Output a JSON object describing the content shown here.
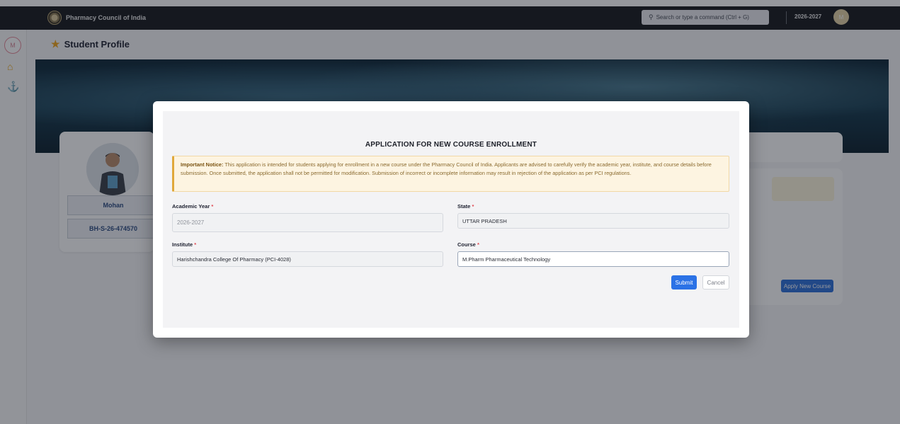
{
  "topbar": {
    "brand": "Pharmacy Council of India",
    "search_placeholder": "Search or type a command (Ctrl + G)",
    "year": "2026-2027",
    "avatar_initial": "M"
  },
  "leftrail": {
    "avatar_initial": "M",
    "icons": [
      "home-icon",
      "anchor-icon"
    ]
  },
  "page": {
    "title": "Student Profile"
  },
  "profile": {
    "name": "Mohan",
    "id": "BH-S-26-474570"
  },
  "side_actions": {
    "apply_label": "Apply New Course"
  },
  "modal": {
    "title": "APPLICATION FOR NEW COURSE ENROLLMENT",
    "notice_heading": "Important Notice:",
    "notice_text": " This application is intended for students applying for enrollment in a new course under the Pharmacy Council of India. Applicants are advised to carefully verify the academic year, institute, and course details before submission. Once submitted, the application shall not be permitted for modification. Submission of incorrect or incomplete information may result in rejection of the application as per PCI regulations.",
    "fields": {
      "academic_year": {
        "label": "Academic Year",
        "value": "2026-2027"
      },
      "state": {
        "label": "State",
        "value": "UTTAR PRADESH"
      },
      "institute": {
        "label": "Institute",
        "value": "Harishchandra College Of Pharmacy (PCI-4028)"
      },
      "course": {
        "label": "Course",
        "value": "M.Pharm Pharmaceutical Technology"
      }
    },
    "required_mark": "*",
    "submit_label": "Submit",
    "cancel_label": "Cancel"
  },
  "colors": {
    "accent": "#2b72e6",
    "topbar": "#17181c",
    "star": "#f0a51b",
    "notice_bg": "#fdf4e1"
  }
}
